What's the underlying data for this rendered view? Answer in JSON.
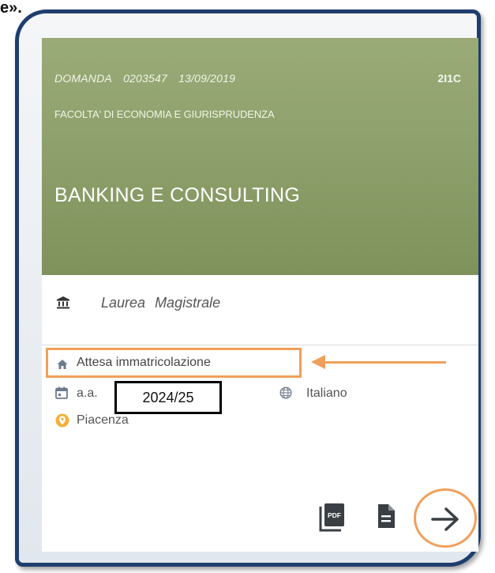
{
  "fragment": {
    "text": "e»."
  },
  "card": {
    "header": {
      "domanda_label": "DOMANDA",
      "domanda_number": "0203547",
      "domanda_date": "13/09/2019",
      "code": "2I1C",
      "faculty": "FACOLTA' DI ECONOMIA E GIURISPRUDENZA",
      "title": "BANKING E CONSULTING",
      "bg_color": "#8d9f6a"
    },
    "degree": {
      "icon": "bank-icon",
      "type_word1": "Laurea",
      "type_word2": "Magistrale"
    },
    "status": {
      "icon": "home-icon",
      "text": "Attesa immatricolazione",
      "highlight_color": "#f0a05a"
    },
    "academic_year": {
      "icon": "calendar-icon",
      "label": "a.a.",
      "value": "2024/25"
    },
    "language": {
      "icon": "globe-icon",
      "value": "Italiano"
    },
    "location": {
      "icon": "location-pin-icon",
      "value": "Piacenza"
    },
    "actions": {
      "pdf_icon": "pdf-icon",
      "doc_icon": "document-icon",
      "next_icon": "arrow-right-icon"
    }
  }
}
